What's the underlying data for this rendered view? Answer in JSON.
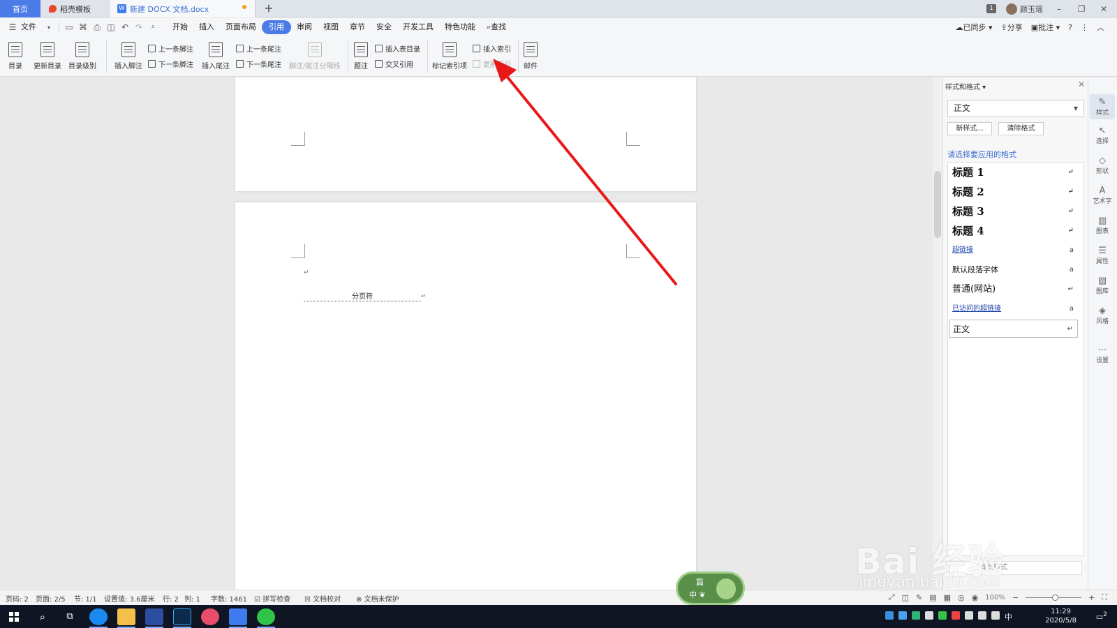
{
  "tabs": {
    "home": "首页",
    "template": "稻壳模板",
    "doc": "新建 DOCX 文档.docx",
    "doc_icon": "W",
    "add": "+"
  },
  "topright": {
    "badge": "1",
    "user": "颜玉瑶",
    "minimize": "–",
    "restore": "❐",
    "close": "✕"
  },
  "menu": {
    "file": "文件",
    "items": [
      "开始",
      "插入",
      "页面布局",
      "引用",
      "审阅",
      "视图",
      "章节",
      "安全",
      "开发工具",
      "特色功能"
    ],
    "active": "引用",
    "search": "查找",
    "synced": "已同步",
    "share": "分享",
    "comment": "批注",
    "help": "?",
    "more": "⋮"
  },
  "ribbon": {
    "toc": "目录",
    "update_toc": "更新目录",
    "toc_level": "目录级别",
    "insert_footnote": "插入脚注",
    "prev_footnote": "上一条脚注",
    "next_footnote": "下一条脚注",
    "insert_endnote": "插入尾注",
    "prev_endnote": "上一条尾注",
    "next_endnote": "下一条尾注",
    "separator": "脚注/尾注分隔线",
    "caption": "题注",
    "insert_table_toc": "插入表目录",
    "cross_ref": "交叉引用",
    "mark_index": "标记索引项",
    "insert_index": "插入索引",
    "update_index": "更新索引",
    "mail": "邮件"
  },
  "document": {
    "pilcrow": "↵",
    "page_break": "分页符"
  },
  "sidepanel": {
    "title": "样式和格式",
    "current_style": "正文",
    "new_style": "新样式...",
    "clear_format": "清除格式",
    "hint": "请选择要应用的格式",
    "styles": [
      {
        "name": "标题 1",
        "mark": "↵"
      },
      {
        "name": "标题 2",
        "mark": "↵"
      },
      {
        "name": "标题 3",
        "mark": "↵"
      },
      {
        "name": "标题 4",
        "mark": "↵"
      },
      {
        "name": "超链接",
        "mark": "a"
      },
      {
        "name": "默认段落字体",
        "mark": "a"
      },
      {
        "name": "普通(网站)",
        "mark": "↵"
      },
      {
        "name": "已访问的超链接",
        "mark": "a"
      },
      {
        "name": "正文",
        "mark": "↵"
      }
    ],
    "bottom": "有效样式"
  },
  "righttools": [
    "样式",
    "选择",
    "形状",
    "艺术字",
    "图表",
    "属性",
    "图库",
    "风格",
    "设置"
  ],
  "status": {
    "page_num": "页码: 2",
    "pages": "页面: 2/5",
    "section": "节: 1/1",
    "setting": "设置值: 3.6厘米",
    "row": "行: 2",
    "col": "列: 1",
    "words": "字数: 1461",
    "spell": "拼写检查",
    "proof": "文档校对",
    "protect": "文档未保护",
    "zoom": "100%"
  },
  "widget": {
    "t1": "篇",
    "t2": "中 ❦"
  },
  "watermark": {
    "main": "Bai 经验",
    "url": "jingyan.baidu.com"
  },
  "clock": {
    "time": "11:29",
    "date": "2020/5/8",
    "ime": "中",
    "notif": "2"
  }
}
